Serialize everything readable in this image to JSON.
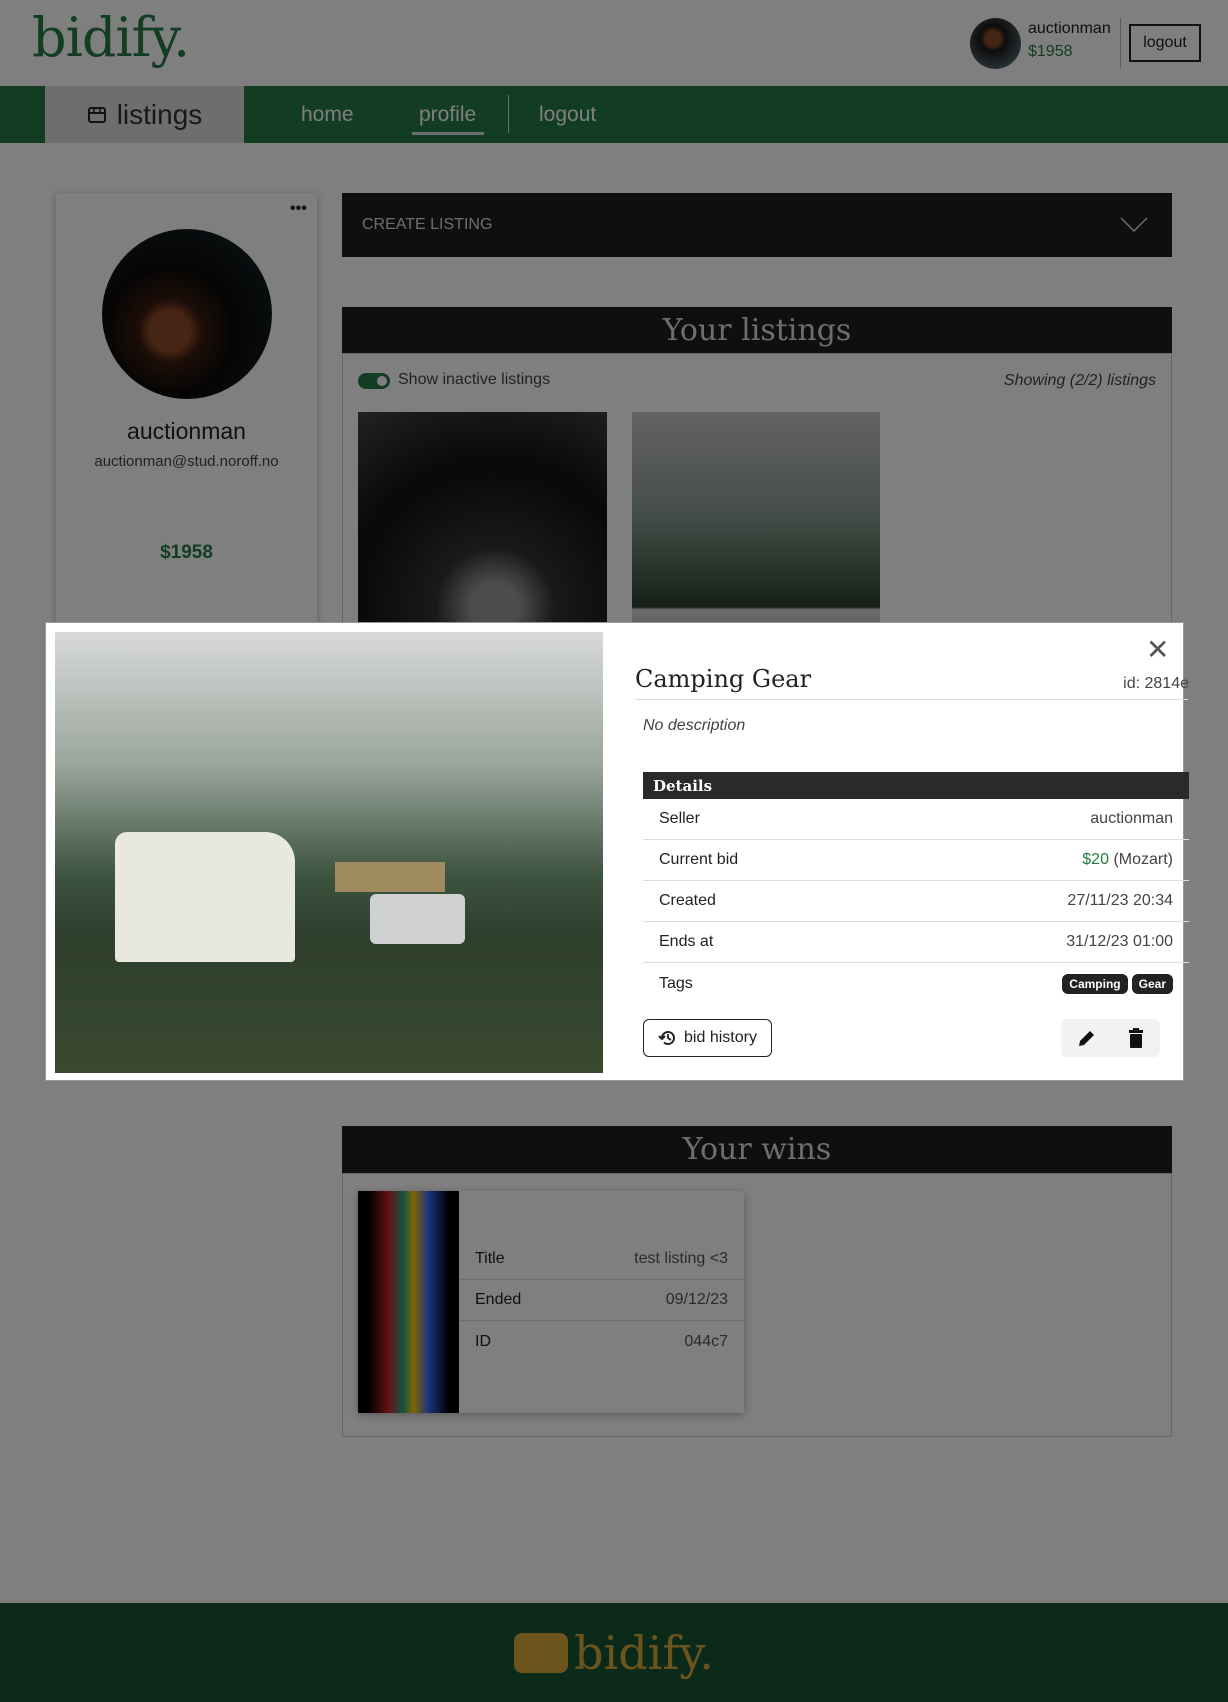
{
  "header": {
    "logo": "bidify.",
    "username": "auctionman",
    "balance": "$1958",
    "logout": "logout"
  },
  "nav": {
    "listings": "listings",
    "home": "home",
    "profile": "profile",
    "logout": "logout"
  },
  "profile": {
    "name": "auctionman",
    "email": "auctionman@stud.noroff.no",
    "balance": "$1958",
    "menu": "•••"
  },
  "create": {
    "label": "CREATE LISTING"
  },
  "listings": {
    "title": "Your listings",
    "toggle_label": "Show inactive listings",
    "toggle_on": true,
    "showing": "Showing (2/2) listings"
  },
  "wins": {
    "title": "Your wins",
    "rows": [
      {
        "k": "Title",
        "v": "test listing <3"
      },
      {
        "k": "Ended",
        "v": "09/12/23"
      },
      {
        "k": "ID",
        "v": "044c7"
      }
    ]
  },
  "modal": {
    "title": "Camping Gear",
    "id": "id: 2814e",
    "description": "No description",
    "details_title": "Details",
    "rows": [
      {
        "k": "Seller",
        "v": "auctionman"
      },
      {
        "k": "Current bid",
        "amount": "$20",
        "bidder": "(Mozart)"
      },
      {
        "k": "Created",
        "v": "27/11/23 20:34"
      },
      {
        "k": "Ends at",
        "v": "31/12/23 01:00"
      },
      {
        "k": "Tags"
      }
    ],
    "tags": [
      "Camping",
      "Gear"
    ],
    "bid_history": "bid history"
  },
  "footer": {
    "logo": "bidify."
  },
  "colors": {
    "brand": "#267a44",
    "footer": "#165434",
    "accent": "#d9a83a"
  }
}
